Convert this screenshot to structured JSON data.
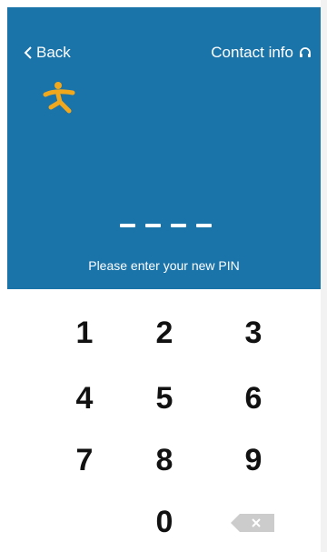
{
  "header": {
    "back_label": "Back",
    "contact_label": "Contact info",
    "prompt": "Please enter your new PIN",
    "pin_length": 4,
    "entered_digits": 0
  },
  "keypad": {
    "keys": [
      "1",
      "2",
      "3",
      "4",
      "5",
      "6",
      "7",
      "8",
      "9",
      "0"
    ]
  },
  "icons": {
    "back": "chevron-left-icon",
    "contact": "headset-icon",
    "logo": "running-person-logo",
    "delete": "backspace-icon"
  },
  "colors": {
    "header_bg": "#1a73a9",
    "logo": "#f2a81d",
    "text_on_header": "#ffffff",
    "key_text": "#111111",
    "delete_key": "#cccccc"
  }
}
